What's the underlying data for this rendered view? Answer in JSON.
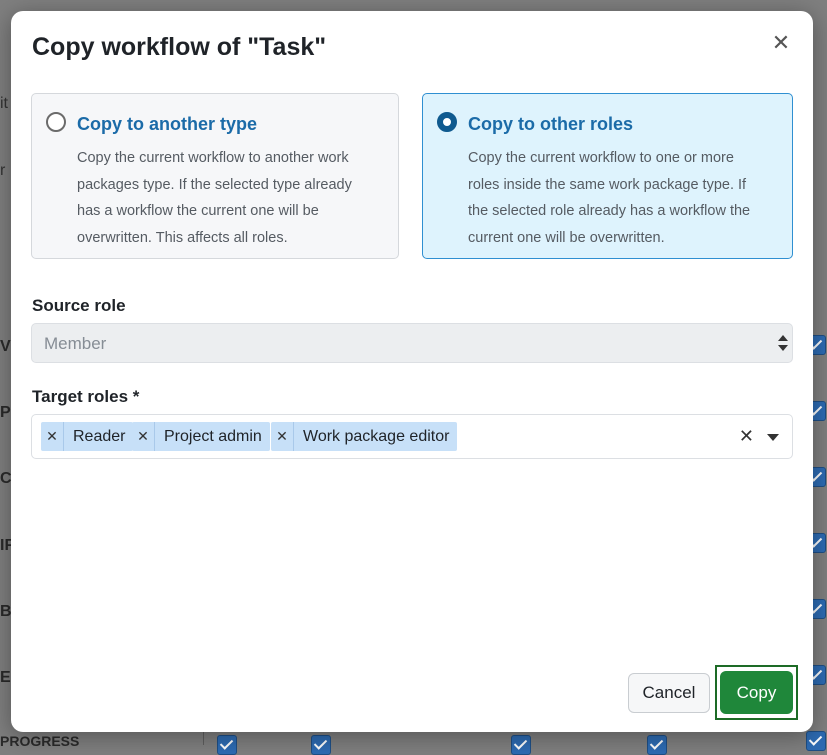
{
  "background": {
    "fragments": [
      "it",
      "r",
      "V",
      "PI",
      "CI",
      "IF",
      "BE",
      "ED",
      "PROGRESS"
    ]
  },
  "modal": {
    "title": "Copy workflow of \"Task\"",
    "close_icon": "close-icon",
    "options": [
      {
        "title": "Copy to another type",
        "description": "Copy the current workflow to another work packages type. If the selected type already has a workflow the current one will be overwritten. This affects all roles.",
        "selected": false
      },
      {
        "title": "Copy to other roles",
        "description": "Copy the current workflow to one or more roles inside the same work package type. If the selected role already has a workflow the current one will be overwritten.",
        "selected": true
      }
    ],
    "source_role": {
      "label": "Source role",
      "value": "Member"
    },
    "target_roles": {
      "label": "Target roles *",
      "selected": [
        "Reader",
        "Project admin",
        "Work package editor"
      ]
    },
    "buttons": {
      "cancel": "Cancel",
      "copy": "Copy"
    }
  },
  "colors": {
    "accent": "#1b6ba8",
    "primary_button": "#1f873a",
    "selected_option_bg": "#def3fd"
  }
}
